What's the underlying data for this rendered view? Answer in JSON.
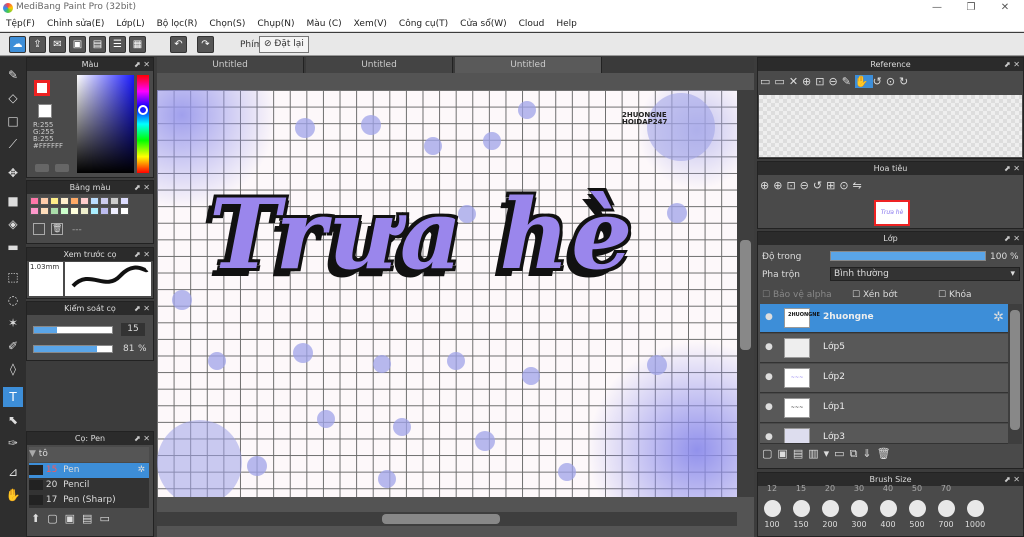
{
  "app": {
    "title": "MediBang Paint Pro (32bit)"
  },
  "menu": [
    "Tệp(F)",
    "Chỉnh sửa(E)",
    "Lớp(L)",
    "Bộ lọc(R)",
    "Chọn(S)",
    "Chụp(N)",
    "Màu (C)",
    "Xem(V)",
    "Công cụ(T)",
    "Cửa sổ(W)",
    "Cloud",
    "Help"
  ],
  "toolbar": {
    "phim_label": "Phím",
    "reset_label": "Đặt lại"
  },
  "tabs": [
    "Untitled",
    "Untitled",
    "Untitled"
  ],
  "color_panel": {
    "title": "Màu",
    "r": "R:255",
    "g": "G:255",
    "b": "B:255",
    "hex": "#FFFFFF"
  },
  "palette_panel": {
    "title": "Bảng màu",
    "dash": "---"
  },
  "preview_panel": {
    "title": "Xem trước cọ",
    "size": "1.03mm"
  },
  "brush_ctrl": {
    "title": "Kiểm soát cọ",
    "size_value": "15",
    "opacity_value": "81",
    "opacity_unit": "%"
  },
  "brush_panel": {
    "title": "Cọ: Pen",
    "group": "tô",
    "items": [
      {
        "num": "15",
        "name": "Pen"
      },
      {
        "num": "20",
        "name": "Pencil"
      },
      {
        "num": "17",
        "name": "Pen (Sharp)"
      }
    ]
  },
  "reference": {
    "title": "Reference"
  },
  "navigator": {
    "title": "Hoa tiêu"
  },
  "layers": {
    "title": "Lớp",
    "opacity_label": "Độ trong",
    "opacity_value": "100 %",
    "blend_label": "Pha trộn",
    "blend_value": "Bình thường",
    "protect_alpha": "Bảo vệ alpha",
    "clip": "Xén bớt",
    "lock": "Khóa",
    "items": [
      "2huongne",
      "Lớp5",
      "Lớp2",
      "Lớp1",
      "Lớp3"
    ]
  },
  "brush_size": {
    "title": "Brush Size",
    "top": [
      "12",
      "15",
      "20",
      "30",
      "40",
      "50",
      "70"
    ],
    "sizes": [
      "100",
      "150",
      "200",
      "300",
      "400",
      "500",
      "700",
      "1000"
    ]
  },
  "canvas": {
    "main_text": "Trưa hè",
    "sig_line1": "2HUONGNE",
    "sig_line2": "HOIDAP247"
  },
  "colors": {
    "accent": "#3d8ed8",
    "text_fill": "#9a86ec",
    "dots": "#9fa3e8"
  }
}
